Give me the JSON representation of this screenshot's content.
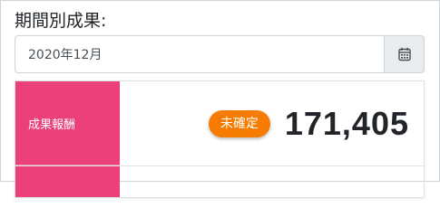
{
  "period": {
    "label": "期間別成果:",
    "input_value": "2020年12月"
  },
  "icons": {
    "calendar": "calendar-icon"
  },
  "rows": [
    {
      "label": "成果報酬",
      "status_badge": "未確定",
      "amount": "171,405"
    }
  ],
  "colors": {
    "row_header_bg": "#ec407a",
    "badge_bg": "#f57c00",
    "amount_text": "#212529"
  }
}
